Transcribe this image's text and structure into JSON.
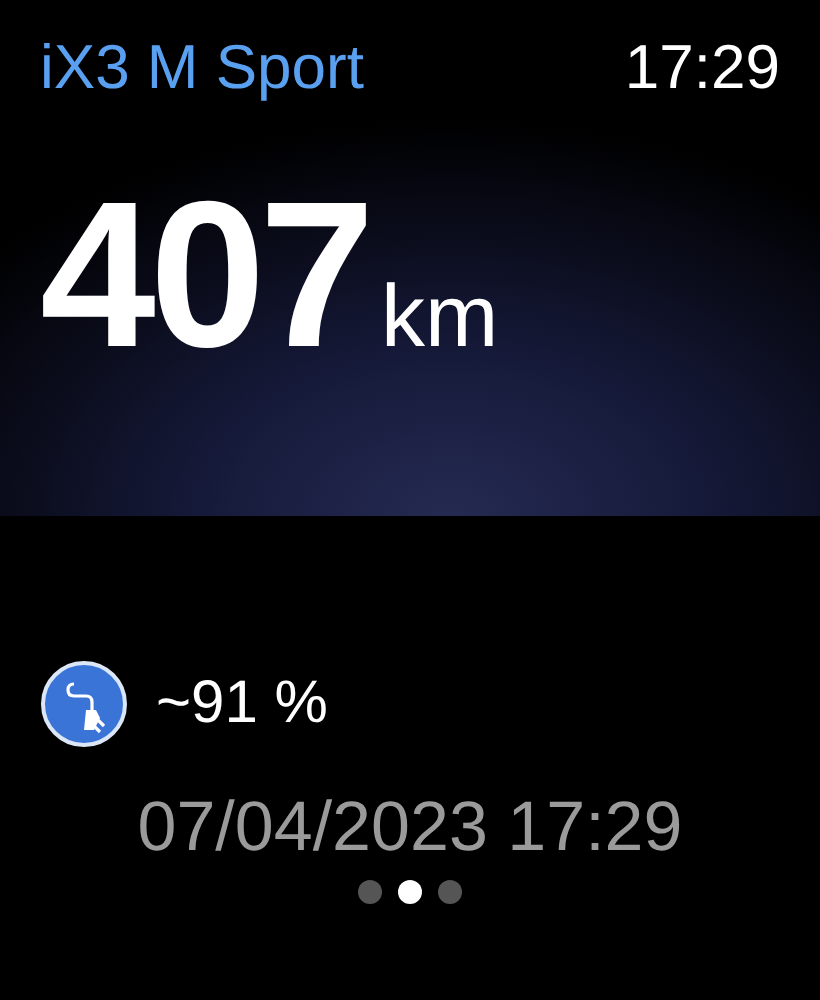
{
  "header": {
    "title": "iX3 M Sport",
    "time": "17:29"
  },
  "range": {
    "value": "407",
    "unit": "km"
  },
  "charge": {
    "reading": "~91 %"
  },
  "timestamp": "07/04/2023 17:29",
  "pages": [
    {
      "selected": false
    },
    {
      "selected": true
    },
    {
      "selected": false
    }
  ]
}
